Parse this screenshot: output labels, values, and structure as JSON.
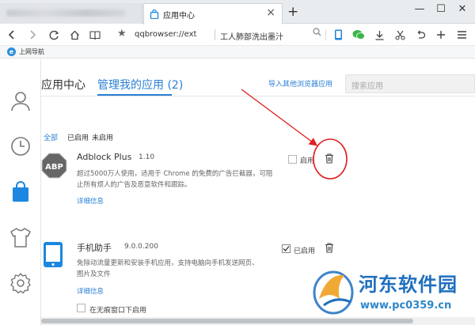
{
  "tabs": {
    "active_title": "应用中心",
    "close_glyph": "×",
    "new_glyph": "+"
  },
  "window": {
    "min_glyph": "—",
    "max_glyph": "☐",
    "close_glyph": "✕"
  },
  "address": {
    "url": "qqbrowser://ext",
    "query": "工人肺部洗出墨汁"
  },
  "bookmarks": {
    "items": [
      {
        "icon": "e",
        "label": "上网导航"
      }
    ]
  },
  "sidebar": {
    "items": [
      "user-icon",
      "clock-icon",
      "shopping-bag-icon",
      "shirt-icon",
      "gear-icon"
    ],
    "active_color": "#1b87e0"
  },
  "page": {
    "tab_center": "应用中心",
    "tab_manage": "管理我的应用 (2)",
    "import_link": "导入其他浏览器应用",
    "search_placeholder": "搜索应用",
    "filters": {
      "all": "全部",
      "enabled": "已启用",
      "disabled": "未启用"
    }
  },
  "apps": [
    {
      "icon": "ABP",
      "name": "Adblock Plus",
      "version": "1.10",
      "desc_line1": "超过5000万人使用，适用于 Chrome 的免费的广告拦截器，可阻",
      "desc_line2": "止所有烦人的广告及恶意软件和跟踪。",
      "detail": "详细信息",
      "enabled": false,
      "enable_label": "启用"
    },
    {
      "icon": "phone-icon",
      "name": "手机助手",
      "version": "9.0.0.200",
      "desc_line1": "免除动流量更新和安装手机应用，支持电脑向手机发送网页、",
      "desc_line2": "图片及文件",
      "detail": "详细信息",
      "enabled": true,
      "enable_label": "已启用",
      "incognito_label": "在无痕窗口下启用"
    }
  ],
  "watermark": {
    "title": "河东软件园",
    "url": "www.pc0359.cn"
  },
  "colors": {
    "accent": "#2a7fd4",
    "annotation": "#e02020"
  }
}
